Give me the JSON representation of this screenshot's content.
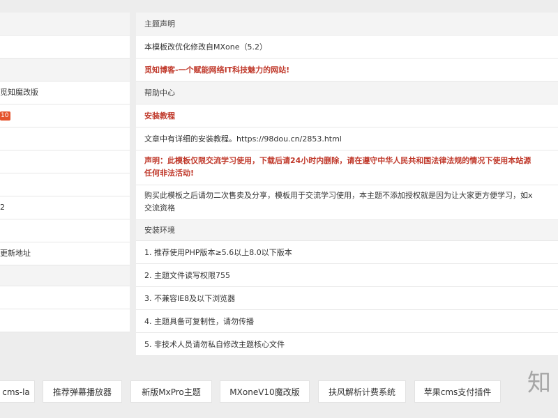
{
  "left_items": [
    {
      "label": ""
    },
    {
      "label": ""
    },
    {
      "label": ""
    },
    {
      "label": "觅知魔改版"
    },
    {
      "label": "10",
      "badge": true
    },
    {
      "label": ""
    },
    {
      "label": ""
    },
    {
      "label": ""
    },
    {
      "label": "2"
    },
    {
      "label": ""
    },
    {
      "label": "更新地址"
    },
    {
      "label": ""
    },
    {
      "label": ""
    },
    {
      "label": ""
    }
  ],
  "right": {
    "section_theme": "主题声明",
    "theme_note": "本模板改优化修改自MXone（5.2）",
    "theme_slogan": "觅知博客-一个赋能网络IT科技魅力的网站!",
    "section_help": "帮助中心",
    "install_tutorial": "安装教程",
    "tutorial_text": "文章中有详细的安装教程。https://98dou.cn/2853.html",
    "disclaimer_line1": "声明：此模板仅限交流学习使用，下载后请24小时内删除，请在遵守中华人民共和国法律法规的情况下使用本站源",
    "disclaimer_line2": "任何非法活动!",
    "purchase_line1": "购买此模板之后请勿二次售卖及分享，模板用于交流学习使用，本主题不添加授权就是因为让大家更方便学习，如x",
    "purchase_line2": "交流资格",
    "section_env": "安装环境",
    "env_items": [
      "1. 推荐使用PHP版本≥5.6以上8.0以下版本",
      "2. 主题文件读写权限755",
      "3. 不兼容IE8及以下浏览器",
      "4. 主题具备可复制性，请勿传播",
      "5. 非技术人员请勿私自修改主题核心文件"
    ]
  },
  "tags": [
    "cms-la",
    "推荐弹幕播放器",
    "新版MxPro主题",
    "MXoneV10魔改版",
    "扶风解析计费系统",
    "苹果cms支付插件"
  ],
  "watermark": "知",
  "colors": {
    "accent_red": "#c0392b",
    "badge_orange": "#e4532c",
    "page_bg": "#ededed"
  }
}
